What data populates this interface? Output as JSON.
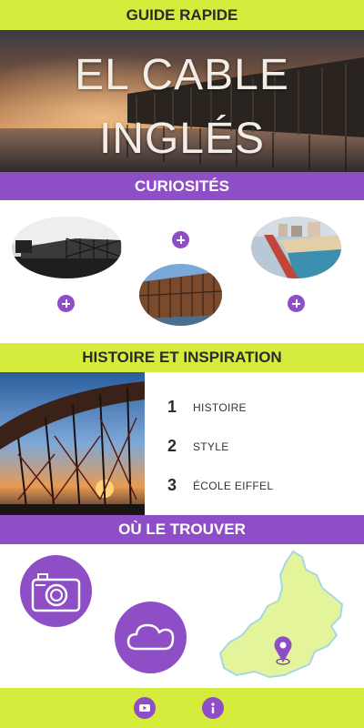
{
  "header": {
    "title": "GUIDE RAPIDE"
  },
  "hero": {
    "title_line1": "EL CABLE",
    "title_line2": "INGLÉS"
  },
  "curiosites": {
    "title": "CURIOSITÉS",
    "photos": [
      {
        "name": "photo-black-white-pier"
      },
      {
        "name": "photo-pier-structure"
      },
      {
        "name": "photo-coastline-aerial"
      }
    ],
    "plus_icon": "plus-icon"
  },
  "histoire": {
    "title": "HISTOIRE ET INSPIRATION",
    "items": [
      {
        "number": "1",
        "label": "HISTOIRE"
      },
      {
        "number": "2",
        "label": "STYLE"
      },
      {
        "number": "3",
        "label": "ÉCOLE EIFFEL"
      }
    ]
  },
  "trouver": {
    "title": "OÙ LE TROUVER",
    "icons": [
      "camera-icon",
      "cloud-icon",
      "map-pin-icon"
    ]
  },
  "footer": {
    "icons": [
      "youtube-icon",
      "info-icon"
    ]
  },
  "colors": {
    "lime": "#d6ec3c",
    "purple": "#8e4ec6",
    "map": "#e4f49a"
  }
}
